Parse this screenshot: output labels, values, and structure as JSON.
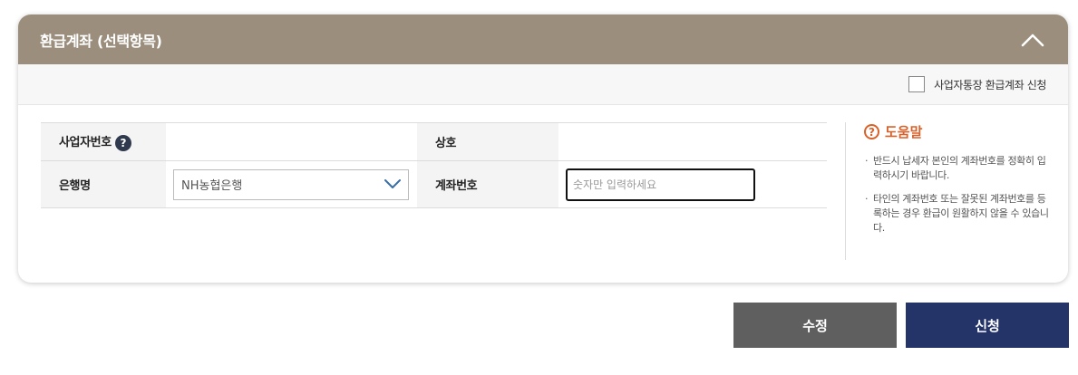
{
  "panel": {
    "title": "환급계좌 (선택항목)",
    "collapse_icon": "chevron-up-icon"
  },
  "options": {
    "business_account_label": "사업자통장 환급계좌 신청",
    "business_account_checked": false
  },
  "form": {
    "business_no_label": "사업자번호",
    "business_no_help": "?",
    "business_no_value": "",
    "company_label": "상호",
    "company_value": "",
    "bank_label": "은행명",
    "bank_selected": "NH농협은행",
    "account_label": "계좌번호",
    "account_placeholder": "숫자만 입력하세요"
  },
  "help": {
    "icon": "?",
    "title": "도움말",
    "items": [
      "반드시 납세자 본인의 계좌번호를 정확히 입력하시기 바랍니다.",
      "타인의 계좌번호 또는 잘못된 계좌번호를 등록하는 경우 환급이 원활하지 않을 수 있습니다."
    ]
  },
  "buttons": {
    "edit_label": "수정",
    "apply_label": "신청"
  },
  "colors": {
    "header_bg": "#9b8e7c",
    "help_accent": "#d9622b",
    "edit_button": "#5f5f5f",
    "apply_button": "#243468"
  }
}
